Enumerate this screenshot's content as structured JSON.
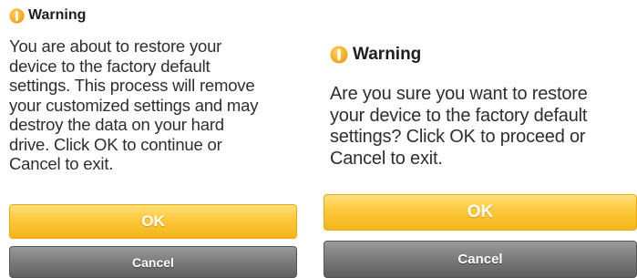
{
  "dialogs": [
    {
      "icon": "warning-icon",
      "title": "Warning",
      "message_lines": [
        "You are about to restore your",
        "device to the factory default",
        "settings. This process will remove",
        "your customized settings and may",
        "destroy the data on your hard",
        "drive. Click OK to continue or",
        "Cancel to exit."
      ],
      "ok_label": "OK",
      "cancel_label": "Cancel"
    },
    {
      "icon": "warning-icon",
      "title": "Warning",
      "message_lines": [
        "Are you sure you want to restore",
        "your device to the factory default",
        "settings? Click OK to proceed or",
        "Cancel to exit."
      ],
      "ok_label": "OK",
      "cancel_label": "Cancel"
    }
  ],
  "colors": {
    "ok_button": "#fcc83a",
    "cancel_button": "#7d7d7d",
    "warning_icon": "#f5a81c",
    "text": "#2e2e2e"
  }
}
